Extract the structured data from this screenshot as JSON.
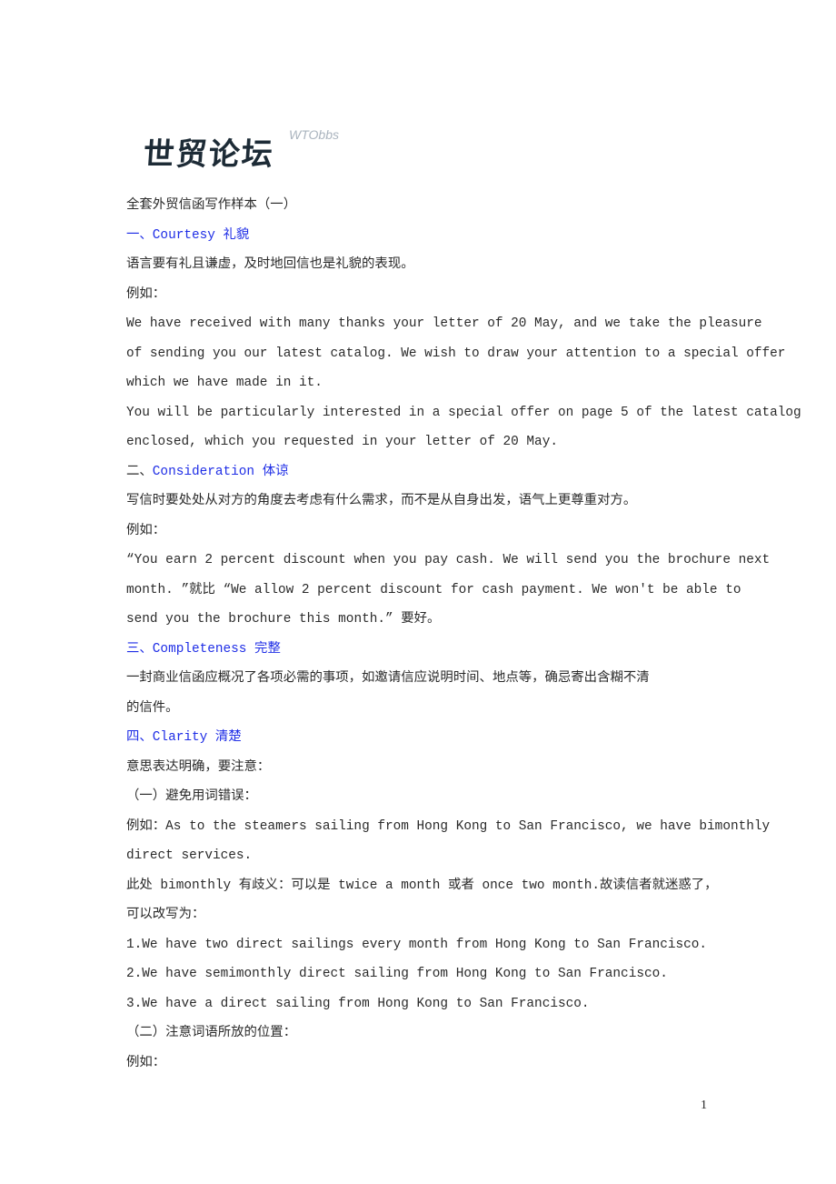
{
  "logo": {
    "chinese": "世贸论坛",
    "english": "WTObbs"
  },
  "document": {
    "title": "全套外贸信函写作样本（一）",
    "sections": {
      "courtesy": {
        "prefix": "一、",
        "heading": "Courtesy 礼貌"
      },
      "consideration": {
        "prefix": "二、",
        "heading": "Consideration 体谅"
      },
      "completeness": {
        "prefix": "三、",
        "heading": "Completeness 完整"
      },
      "clarity": {
        "prefix": "四、",
        "heading": "Clarity 清楚"
      }
    },
    "lines": {
      "courtesy_desc": "语言要有礼且谦虚，及时地回信也是礼貌的表现。",
      "example_label_1": "例如：",
      "courtesy_ex1_l1": "We have received with many thanks your letter of 20 May, and we take the pleasure",
      "courtesy_ex1_l2": "of sending you our latest catalog. We wish to draw your attention to a special offer",
      "courtesy_ex1_l3": "which we have made in it.",
      "courtesy_ex2_l1": "You will be particularly interested in a special offer on page 5 of the latest catalog",
      "courtesy_ex2_l2": "enclosed, which you requested in your letter of 20 May.",
      "consideration_desc": "写信时要处处从对方的角度去考虑有什么需求，而不是从自身出发，语气上更尊重对方。",
      "example_label_2": "例如：",
      "consideration_ex_l1": "“You earn 2 percent discount when you pay cash. We will send you the brochure next",
      "consideration_ex_l2": "month. ”就比 “We allow 2 percent discount for cash payment. We won't be able to",
      "consideration_ex_l3": "send you the brochure this month.” 要好。",
      "completeness_desc_l1": "一封商业信函应概况了各项必需的事项，如邀请信应说明时间、地点等，确忌寄出含糊不清",
      "completeness_desc_l2": "的信件。",
      "clarity_desc": "意思表达明确，要注意：",
      "clarity_sub1": "（一）避免用词错误：",
      "clarity_ex_l1": "例如：As to the steamers sailing from Hong Kong to San Francisco, we have bimonthly",
      "clarity_ex_l2": "direct services.",
      "clarity_note_l1": "此处 bimonthly 有歧义：可以是 twice a month 或者 once two month.故读信者就迷惑了，",
      "clarity_note_l2": "可以改写为：",
      "rewrite_1": "1.We have two direct sailings every month from Hong Kong to San Francisco.",
      "rewrite_2": "2.We have semimonthly direct sailing from Hong Kong to San Francisco.",
      "rewrite_3": "3.We have a direct sailing from Hong Kong to San Francisco.",
      "clarity_sub2": "（二）注意词语所放的位置：",
      "example_label_3": "例如："
    }
  },
  "page_number": "1",
  "colors": {
    "heading_blue": "#1f2ee6",
    "body_text": "#2a2a2a"
  }
}
